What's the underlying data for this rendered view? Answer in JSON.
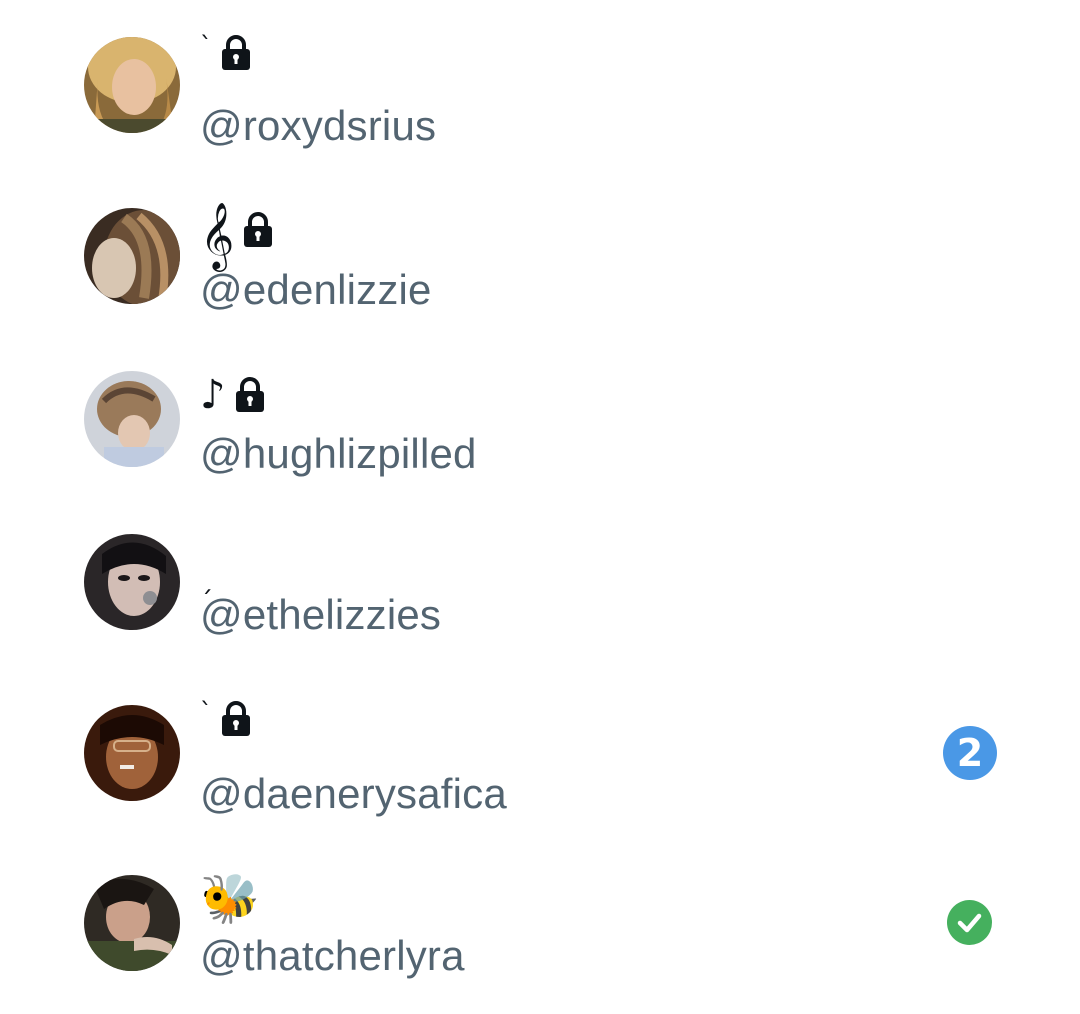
{
  "accounts": [
    {
      "display_name": "ˋ",
      "locked": true,
      "handle": "@roxydsrius"
    },
    {
      "display_name": "𝄞",
      "locked": true,
      "handle": "@edenlizzie"
    },
    {
      "display_name": "♪",
      "locked": true,
      "handle": "@hughlizpilled"
    },
    {
      "display_name": "ˏ",
      "locked": false,
      "handle": "@ethelizzies"
    },
    {
      "display_name": "ˋ",
      "locked": true,
      "handle": "@daenerysafica",
      "badge": "2",
      "badge_color": "#4a98e6"
    },
    {
      "display_name": "🐝",
      "locked": false,
      "handle": "@thatcherlyra",
      "badge_icon": "check-circle-icon",
      "badge_color": "#45b05e"
    }
  ],
  "colors": {
    "handle_text": "#536471",
    "name_text": "#0f1419",
    "background": "#ffffff"
  }
}
